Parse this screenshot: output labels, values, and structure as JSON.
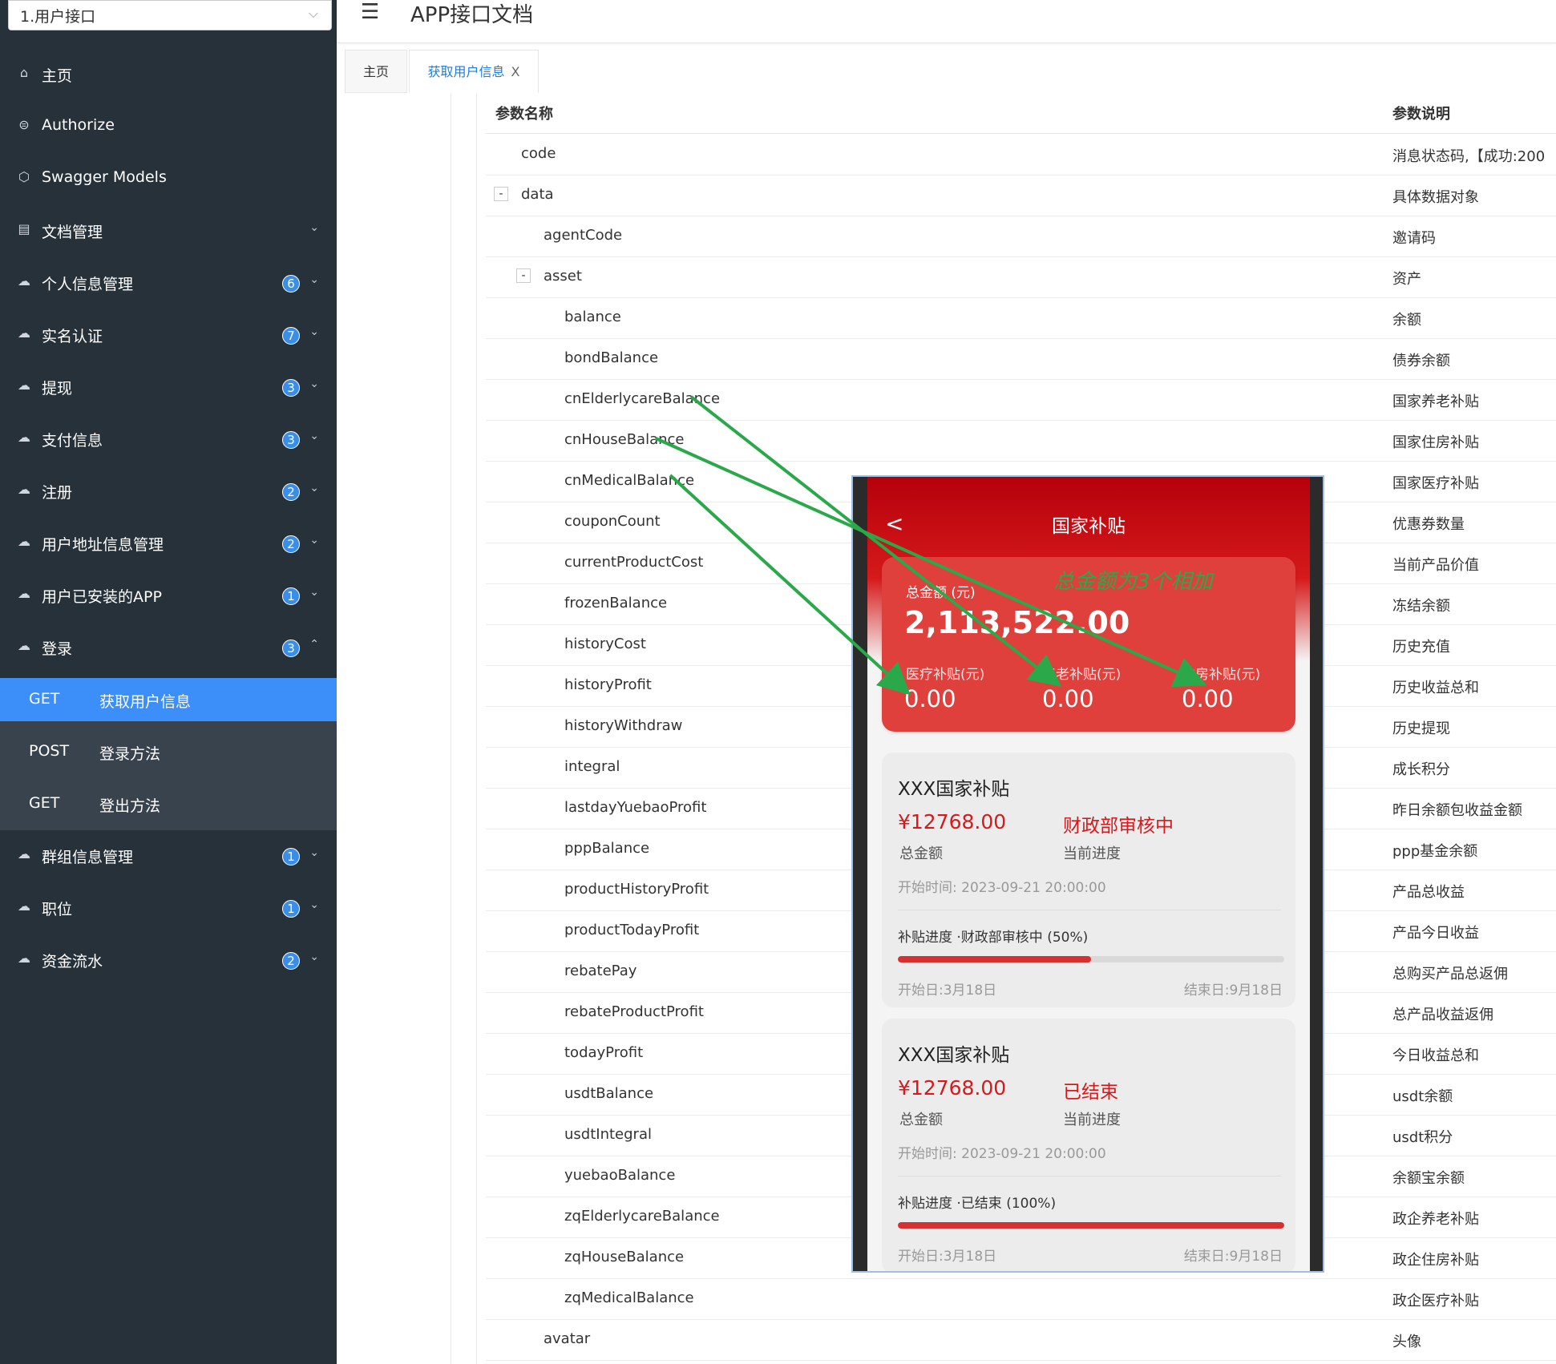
{
  "sidebar": {
    "group_select": "1.用户接口",
    "items": [
      {
        "label": "主页",
        "icon": "home-icon",
        "badge": "",
        "arrow": ""
      },
      {
        "label": "Authorize",
        "icon": "lock-icon",
        "badge": "",
        "arrow": ""
      },
      {
        "label": "Swagger Models",
        "icon": "cube-icon",
        "badge": "",
        "arrow": ""
      },
      {
        "label": "文档管理",
        "icon": "document-icon",
        "badge": "",
        "arrow": "⌄"
      },
      {
        "label": "个人信息管理",
        "icon": "cloud-icon",
        "badge": "6",
        "arrow": "⌄"
      },
      {
        "label": "实名认证",
        "icon": "cloud-icon",
        "badge": "7",
        "arrow": "⌄"
      },
      {
        "label": "提现",
        "icon": "cloud-icon",
        "badge": "3",
        "arrow": "⌄"
      },
      {
        "label": "支付信息",
        "icon": "cloud-icon",
        "badge": "3",
        "arrow": "⌄"
      },
      {
        "label": "注册",
        "icon": "cloud-icon",
        "badge": "2",
        "arrow": "⌄"
      },
      {
        "label": "用户地址信息管理",
        "icon": "cloud-icon",
        "badge": "2",
        "arrow": "⌄"
      },
      {
        "label": "用户已安装的APP",
        "icon": "cloud-icon",
        "badge": "1",
        "arrow": "⌄"
      },
      {
        "label": "登录",
        "icon": "cloud-icon",
        "badge": "3",
        "arrow": "⌃"
      },
      {
        "label": "群组信息管理",
        "icon": "cloud-icon",
        "badge": "1",
        "arrow": "⌄"
      },
      {
        "label": "职位",
        "icon": "cloud-icon",
        "badge": "1",
        "arrow": "⌄"
      },
      {
        "label": "资金流水",
        "icon": "cloud-icon",
        "badge": "2",
        "arrow": "⌄"
      }
    ],
    "submenu": [
      {
        "method": "GET",
        "name": "获取用户信息",
        "active": true
      },
      {
        "method": "POST",
        "name": "登录方法",
        "active": false
      },
      {
        "method": "GET",
        "name": "登出方法",
        "active": false
      }
    ]
  },
  "header": {
    "title": "APP接口文档"
  },
  "tabs": [
    {
      "label": "主页",
      "close": ""
    },
    {
      "label": "获取用户信息",
      "close": "X"
    }
  ],
  "table": {
    "col_name": "参数名称",
    "col_desc": "参数说明",
    "rows": [
      {
        "name": "code",
        "desc": "消息状态码,【成功:200",
        "toggle": ""
      },
      {
        "name": "data",
        "desc": "具体数据对象",
        "toggle": "-"
      },
      {
        "name": "agentCode",
        "desc": "邀请码",
        "toggle": ""
      },
      {
        "name": "asset",
        "desc": "资产",
        "toggle": "-"
      },
      {
        "name": "balance",
        "desc": "余额",
        "toggle": ""
      },
      {
        "name": "bondBalance",
        "desc": "债券余额",
        "toggle": ""
      },
      {
        "name": "cnElderlycareBalance",
        "desc": "国家养老补贴",
        "toggle": ""
      },
      {
        "name": "cnHouseBalance",
        "desc": "国家住房补贴",
        "toggle": ""
      },
      {
        "name": "cnMedicalBalance",
        "desc": "国家医疗补贴",
        "toggle": ""
      },
      {
        "name": "couponCount",
        "desc": "优惠券数量",
        "toggle": ""
      },
      {
        "name": "currentProductCost",
        "desc": "当前产品价值",
        "toggle": ""
      },
      {
        "name": "frozenBalance",
        "desc": "冻结余额",
        "toggle": ""
      },
      {
        "name": "historyCost",
        "desc": "历史充值",
        "toggle": ""
      },
      {
        "name": "historyProfit",
        "desc": "历史收益总和",
        "toggle": ""
      },
      {
        "name": "historyWithdraw",
        "desc": "历史提现",
        "toggle": ""
      },
      {
        "name": "integral",
        "desc": "成长积分",
        "toggle": ""
      },
      {
        "name": "lastdayYuebaoProfit",
        "desc": "昨日余额包收益金额",
        "toggle": ""
      },
      {
        "name": "pppBalance",
        "desc": "ppp基金余额",
        "toggle": ""
      },
      {
        "name": "productHistoryProfit",
        "desc": "产品总收益",
        "toggle": ""
      },
      {
        "name": "productTodayProfit",
        "desc": "产品今日收益",
        "toggle": ""
      },
      {
        "name": "rebatePay",
        "desc": "总购买产品总返佣",
        "toggle": ""
      },
      {
        "name": "rebateProductProfit",
        "desc": "总产品收益返佣",
        "toggle": ""
      },
      {
        "name": "todayProfit",
        "desc": "今日收益总和",
        "toggle": ""
      },
      {
        "name": "usdtBalance",
        "desc": "usdt余额",
        "toggle": ""
      },
      {
        "name": "usdtIntegral",
        "desc": "usdt积分",
        "toggle": ""
      },
      {
        "name": "yuebaoBalance",
        "desc": "余额宝余额",
        "toggle": ""
      },
      {
        "name": "zqElderlycareBalance",
        "desc": "政企养老补贴",
        "toggle": ""
      },
      {
        "name": "zqHouseBalance",
        "desc": "政企住房补贴",
        "toggle": ""
      },
      {
        "name": "zqMedicalBalance",
        "desc": "政企医疗补贴",
        "toggle": ""
      },
      {
        "name": "avatar",
        "desc": "头像",
        "toggle": ""
      }
    ]
  },
  "phone": {
    "title": "国家补贴",
    "back": "<",
    "annotation": "总金额为3个相加",
    "total_label": "总金额 (元)",
    "total_value": "2,113,522.00",
    "subs": [
      {
        "label": "医疗补贴(元)",
        "value": "0.00"
      },
      {
        "label": "养老补贴(元)",
        "value": "0.00"
      },
      {
        "label": "住房补贴(元)",
        "value": "0.00"
      }
    ],
    "cards": [
      {
        "title": "XXX国家补贴",
        "amount": "¥12768.00",
        "amount_label": "总金额",
        "status": "财政部审核中",
        "status_label": "当前进度",
        "start_time": "开始时间: 2023-09-21 20:00:00",
        "progress_label": "补贴进度 ·财政部审核中 (50%)",
        "progress": 0.5,
        "start_date": "开始日:3月18日",
        "end_date": "结束日:9月18日"
      },
      {
        "title": "XXX国家补贴",
        "amount": "¥12768.00",
        "amount_label": "总金额",
        "status": "已结束",
        "status_label": "当前进度",
        "start_time": "开始时间: 2023-09-21 20:00:00",
        "progress_label": "补贴进度 ·已结束 (100%)",
        "progress": 1.0,
        "start_date": "开始日:3月18日",
        "end_date": "结束日:9月18日"
      }
    ]
  },
  "colors": {
    "accent": "#3c8ef8",
    "sidebar": "#26313a",
    "red": "#d7191b",
    "arrow": "#2aa84a"
  }
}
